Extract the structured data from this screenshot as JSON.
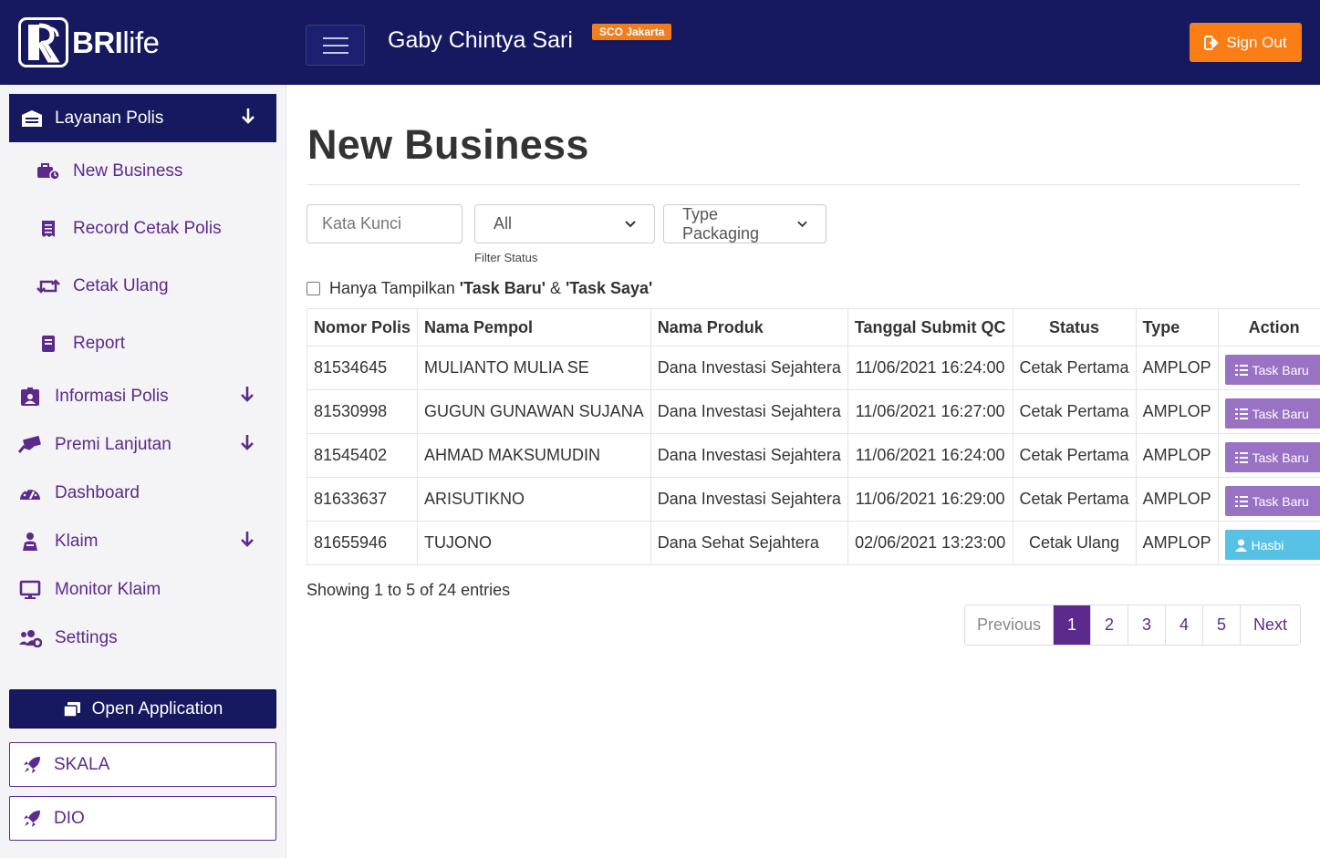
{
  "header": {
    "logo_text_bold": "BRI",
    "logo_text_thin": "life",
    "user_name": "Gaby Chintya Sari",
    "branch_badge": "SCO Jakarta",
    "sign_out_label": "Sign Out"
  },
  "sidebar": {
    "active_menu": "Layanan Polis",
    "sub_items": [
      "New Business",
      "Record Cetak Polis",
      "Cetak Ulang",
      "Report"
    ],
    "menu_items": [
      "Informasi Polis",
      "Premi Lanjutan",
      "Dashboard",
      "Klaim",
      "Monitor Klaim",
      "Settings"
    ],
    "open_app_label": "Open Application",
    "external_apps": [
      "SKALA",
      "DIO"
    ]
  },
  "main": {
    "page_title": "New Business",
    "search_placeholder": "Kata Kunci",
    "status_select_value": "All",
    "status_label": "Filter Status",
    "type_select_value": "Type Packaging",
    "checkbox_label_prefix": "Hanya Tampilkan ",
    "checkbox_label_task_baru": "'Task Baru'",
    "checkbox_label_amp": " & ",
    "checkbox_label_task_saya": "'Task Saya'",
    "table": {
      "headers": [
        "Nomor Polis",
        "Nama Pempol",
        "Nama Produk",
        "Tanggal Submit QC",
        "Status",
        "Type",
        "Action"
      ],
      "rows": [
        [
          "81534645",
          "MULIANTO MULIA SE",
          "Dana Investasi Sejahtera",
          "11/06/2021 16:24:00",
          "Cetak Pertama",
          "AMPLOP",
          "Task Baru"
        ],
        [
          "81530998",
          "GUGUN GUNAWAN SUJANA",
          "Dana Investasi Sejahtera",
          "11/06/2021 16:27:00",
          "Cetak Pertama",
          "AMPLOP",
          "Task Baru"
        ],
        [
          "81545402",
          "AHMAD MAKSUMUDIN",
          "Dana Investasi Sejahtera",
          "11/06/2021 16:24:00",
          "Cetak Pertama",
          "AMPLOP",
          "Task Baru"
        ],
        [
          "81633637",
          "ARISUTIKNO",
          "Dana Investasi Sejahtera",
          "11/06/2021 16:29:00",
          "Cetak Pertama",
          "AMPLOP",
          "Task Baru"
        ],
        [
          "81655946",
          "TUJONO",
          "Dana Sehat Sejahtera",
          "02/06/2021 13:23:00",
          "Cetak Ulang",
          "AMPLOP",
          "Hasbi"
        ]
      ]
    },
    "showing_text": "Showing 1 to 5 of 24 entries",
    "pagination": [
      "Previous",
      "1",
      "2",
      "3",
      "4",
      "5",
      "Next"
    ],
    "active_page": "1"
  },
  "colors": {
    "header_bg": "#16195f",
    "accent_purple": "#5b2a8c",
    "sign_out": "#fb7d16",
    "task_btn": "#9a72c3",
    "assignee_btn": "#57c2e6"
  }
}
